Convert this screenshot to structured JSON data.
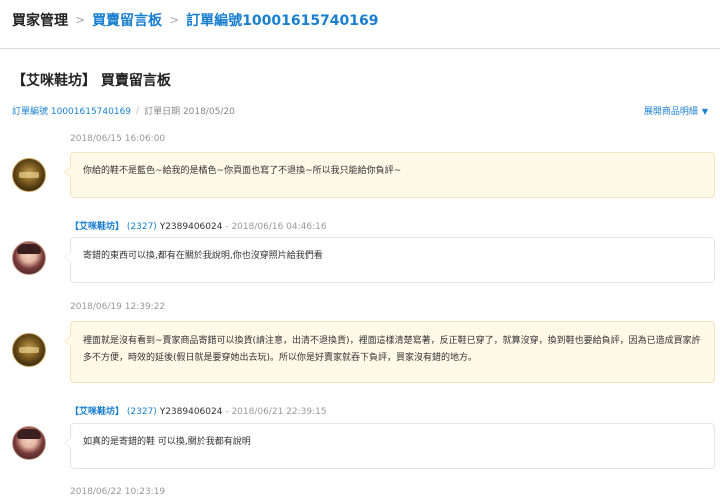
{
  "breadcrumb": {
    "items": [
      "買家管理",
      "買賣留言板",
      "訂單編號10001615740169"
    ],
    "separator": ">"
  },
  "page": {
    "title": "【艾咪鞋坊】 買賣留言板"
  },
  "order": {
    "id_text": "訂單編號 10001615740169",
    "separator": "/",
    "date_text": "訂單日期 2018/05/20",
    "expand_label": "展開商品明細",
    "expand_icon": "chevron-down-icon"
  },
  "messages": [
    {
      "timestamp": "2018/06/15 16:06:00",
      "text": "你給的鞋不是藍色~給我的是橘色~你頁面也寫了不退換~所以我只能給你負評~"
    },
    {
      "shop": "【艾咪鞋坊】",
      "rating": "(2327)",
      "account": "Y2389406024",
      "timestamp": "- 2018/06/16 04:46:16",
      "text": "寄錯的東西可以換,都有在關於我說明,你也沒穿照片給我們看"
    },
    {
      "timestamp": "2018/06/19 12:39:22",
      "text": "裡面就是沒有看到~賣家商品寄錯可以換貨(請注意，出清不退換貨)，裡面這樣清楚寫著，反正鞋已穿了，就算沒穿，換到鞋也要給負評，因為已造成買家許多不方便，時效的延後(假日就是要穿她出去玩)。所以你是好賣家就吞下負評，買家沒有錯的地方。"
    },
    {
      "shop": "【艾咪鞋坊】",
      "rating": "(2327)",
      "account": "Y2389406024",
      "timestamp": "- 2018/06/21 22:39:15",
      "text": "如真的是寄錯的鞋 可以換,關於我都有說明"
    },
    {
      "timestamp": "2018/06/22 10:23:19"
    }
  ],
  "colors": {
    "link": "#1a7fcf",
    "buyer_bubble": "#fff9e8",
    "seller_bubble": "#ffffff"
  }
}
